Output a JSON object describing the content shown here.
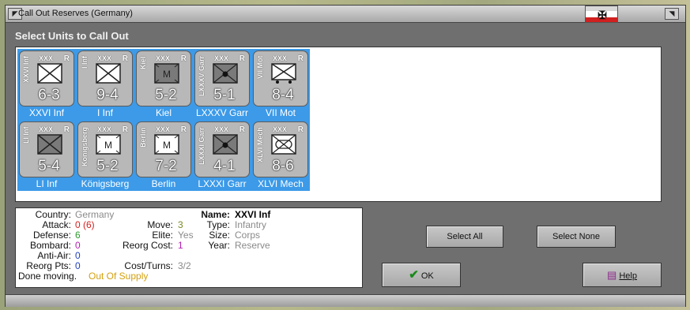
{
  "window": {
    "title": "Call Out Reserves (Germany)"
  },
  "header": "Select Units to Call Out",
  "units": [
    {
      "side": "XXVI Inf",
      "size": "XXX",
      "r": "R",
      "value": "6-3",
      "name": "XXVI Inf",
      "symbol": "infantry"
    },
    {
      "side": "I Inf",
      "size": "XXX",
      "r": "R",
      "value": "9-4",
      "name": "I Inf",
      "symbol": "infantry"
    },
    {
      "side": "Kiel",
      "size": "XXX",
      "r": "R",
      "value": "5-2",
      "name": "Kiel",
      "symbol": "mountain-dark"
    },
    {
      "side": "LXXXV Garr",
      "size": "XXX",
      "r": "R",
      "value": "5-1",
      "name": "LXXXV Garr",
      "symbol": "garrison"
    },
    {
      "side": "VII Mot",
      "size": "XXX",
      "r": "R",
      "value": "8-4",
      "name": "VII Mot",
      "symbol": "motorized"
    },
    {
      "side": "LI Inf",
      "size": "XXX",
      "r": "R",
      "value": "5-4",
      "name": "LI Inf",
      "symbol": "infantry-dark"
    },
    {
      "side": "Königsberg",
      "size": "XXX",
      "r": "R",
      "value": "5-2",
      "name": "Königsberg",
      "symbol": "mountain"
    },
    {
      "side": "Berlin",
      "size": "XXX",
      "r": "R",
      "value": "7-2",
      "name": "Berlin",
      "symbol": "mountain"
    },
    {
      "side": "LXXXI Garr",
      "size": "XXX",
      "r": "R",
      "value": "4-1",
      "name": "LXXXI Garr",
      "symbol": "garrison"
    },
    {
      "side": "XLVI Mech",
      "size": "XXX",
      "r": "R",
      "value": "8-6",
      "name": "XLVI Mech",
      "symbol": "mechanized"
    }
  ],
  "info": {
    "country_label": "Country:",
    "country": "Germany",
    "attack_label": "Attack:",
    "attack": "0 (6)",
    "defense_label": "Defense:",
    "defense": "6",
    "bombard_label": "Bombard:",
    "bombard": "0",
    "antiair_label": "Anti-Air:",
    "antiair": "0",
    "reorg_label": "Reorg Pts:",
    "reorg": "0",
    "move_label": "Move:",
    "move": "3",
    "elite_label": "Elite:",
    "elite": "Yes",
    "reorgcost_label": "Reorg Cost:",
    "reorgcost": "1",
    "costturns_label": "Cost/Turns:",
    "costturns": "3/2",
    "name_label": "Name:",
    "name": "XXVI Inf",
    "type_label": "Type:",
    "type": "Infantry",
    "size_label": "Size:",
    "size": "Corps",
    "year_label": "Year:",
    "year": "Reserve",
    "done_label": "Done moving.",
    "done": "Out Of Supply"
  },
  "buttons": {
    "select_all": "Select All",
    "select_none": "Select None",
    "ok": "OK",
    "help": "Help"
  },
  "colors": {
    "selection": "#3c9ae8",
    "counter": "#b8b8b8"
  }
}
